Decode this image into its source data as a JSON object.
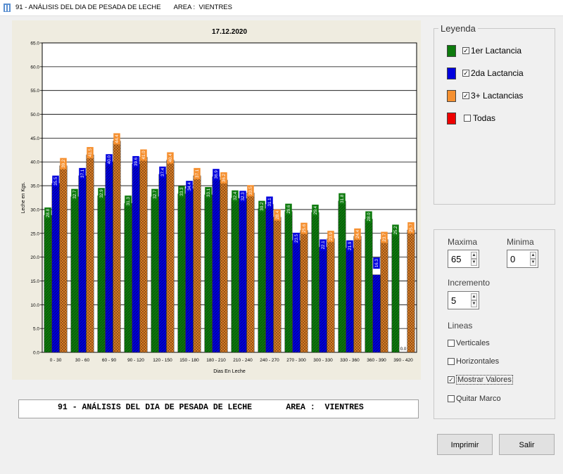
{
  "window": {
    "title": "91 - ANÁLISIS DEL DIA DE PESADA DE LECHE       AREA :  VIENTRES"
  },
  "caption": "91 - ANÁLISIS DEL DIA DE PESADA DE LECHE       AREA :  VIENTRES",
  "legend": {
    "title": "Leyenda",
    "items": [
      {
        "label": "1er Lactancia",
        "color": "#0d7a0d",
        "checked": true
      },
      {
        "label": "2da Lactancia",
        "color": "#0000dd",
        "checked": true
      },
      {
        "label": "3+ Lactancias",
        "color": "#f59030",
        "checked": true
      },
      {
        "label": "Todas",
        "color": "#ee0000",
        "checked": false
      }
    ]
  },
  "settings": {
    "maxima_label": "Maxima",
    "maxima_value": "65",
    "minima_label": "Minima",
    "minima_value": "0",
    "incremento_label": "Incremento",
    "incremento_value": "5",
    "lineas_label": "Lineas",
    "options": [
      {
        "label": "Verticales",
        "checked": false
      },
      {
        "label": "Horizontales",
        "checked": false
      },
      {
        "label": "Mostrar Valores",
        "checked": true
      },
      {
        "label": "Quitar Marco",
        "checked": false
      }
    ]
  },
  "buttons": {
    "print": "Imprimir",
    "exit": "Salir"
  },
  "chart_data": {
    "type": "bar",
    "title": "17.12.2020",
    "xlabel": "Dias En Leche",
    "ylabel": "Leche en Kgs.",
    "ylim": [
      0,
      65
    ],
    "y_step": 5,
    "grid": "horizontal",
    "categories": [
      "0 - 30",
      "30 - 60",
      "60 - 90",
      "90 - 120",
      "120 - 150",
      "150 - 180",
      "180 - 210",
      "210 - 240",
      "240 - 270",
      "270 - 300",
      "300 - 330",
      "330 - 360",
      "360 - 390",
      "390 - 420"
    ],
    "series": [
      {
        "name": "1er Lactancia",
        "color": "#0d7a0d",
        "values": [
          28.8,
          32.7,
          32.9,
          31.3,
          32.7,
          33.3,
          33.1,
          32.4,
          30.2,
          29.6,
          29.4,
          31.8,
          28.0,
          25.2
        ]
      },
      {
        "name": "2da Lactancia",
        "color": "#0000dd",
        "values": [
          35.5,
          37.1,
          40.0,
          39.6,
          37.4,
          34.4,
          36.9,
          32.3,
          31.1,
          23.5,
          22.1,
          21.9,
          16.3,
          0.0
        ]
      },
      {
        "name": "3+ Lactancias",
        "color": "#f59030",
        "values": [
          39.2,
          41.5,
          44.4,
          41.0,
          40.4,
          37.1,
          36.2,
          33.5,
          28.4,
          25.6,
          23.9,
          24.4,
          23.7,
          25.7
        ]
      }
    ]
  }
}
